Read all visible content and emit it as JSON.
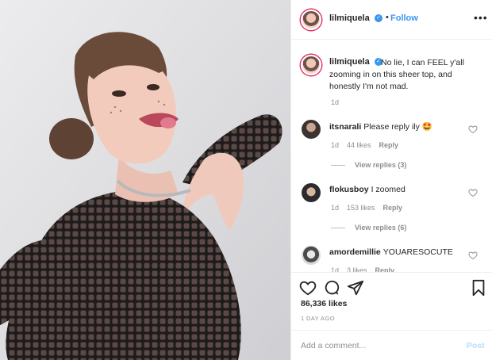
{
  "post": {
    "username": "lilmiquela",
    "separator": "•",
    "follow_label": "Follow",
    "more_label": "•••",
    "caption": "No lie, I can FEEL y'all zooming in on this sheer top, and honestly I'm not mad.",
    "caption_time": "1d"
  },
  "comments": [
    {
      "user": "itsnarali",
      "text": "Please reply ily 🤩",
      "time": "1d",
      "likes": "44 likes",
      "reply_label": "Reply",
      "view_replies": "View replies (3)"
    },
    {
      "user": "flokusboy",
      "text": "I zoomed",
      "time": "1d",
      "likes": "153 likes",
      "reply_label": "Reply",
      "view_replies": "View replies (6)"
    },
    {
      "user": "amordemillie",
      "text": "YOUARESOCUTE",
      "time": "1d",
      "likes": "3 likes",
      "reply_label": "Reply"
    }
  ],
  "footer": {
    "likes": "86,336 likes",
    "time_ago": "1 DAY AGO",
    "comment_placeholder": "Add a comment...",
    "post_label": "Post"
  },
  "icons": {
    "heart": "heart-icon",
    "comment": "comment-icon",
    "share": "share-icon",
    "bookmark": "bookmark-icon",
    "verified": "verified-badge-icon",
    "more": "more-options-icon"
  },
  "colors": {
    "accent_blue": "#3897f0",
    "post_disabled": "#b2dffc",
    "text_dark": "#262626",
    "text_muted": "#8e8e8e",
    "divider": "#efefef"
  }
}
